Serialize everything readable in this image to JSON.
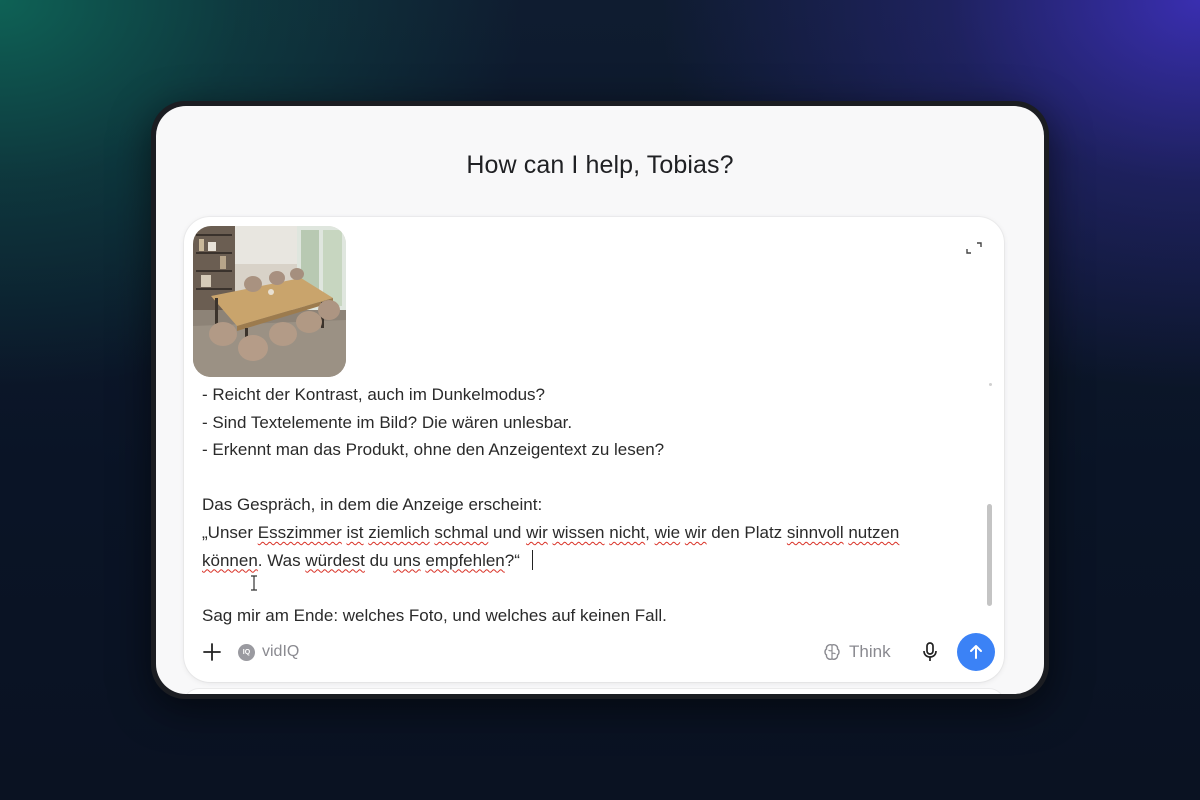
{
  "greeting": "How can I help, Tobias?",
  "prompt_lines": [
    [
      {
        "t": "- Reicht der Kontrast, auch im Dunkelmodus?"
      }
    ],
    [
      {
        "t": "- Sind Textelemente im Bild? Die wären unlesbar."
      }
    ],
    [
      {
        "t": "- Erkennt man das Produkt, ohne den Anzeigentext zu lesen?"
      }
    ],
    [],
    [
      {
        "t": "Das Gespräch, in dem die Anzeige erscheint:"
      }
    ],
    [
      {
        "t": "„Unser "
      },
      {
        "t": "Esszimmer",
        "s": 1
      },
      {
        "t": " "
      },
      {
        "t": "ist",
        "s": 1
      },
      {
        "t": " "
      },
      {
        "t": "ziemlich",
        "s": 1
      },
      {
        "t": " "
      },
      {
        "t": "schmal",
        "s": 1
      },
      {
        "t": " und "
      },
      {
        "t": "wir",
        "s": 1
      },
      {
        "t": " "
      },
      {
        "t": "wissen",
        "s": 1
      },
      {
        "t": " "
      },
      {
        "t": "nicht",
        "s": 1
      },
      {
        "t": ", "
      },
      {
        "t": "wie",
        "s": 1
      },
      {
        "t": " "
      },
      {
        "t": "wir",
        "s": 1
      },
      {
        "t": " den Platz "
      },
      {
        "t": "sinnvoll",
        "s": 1
      },
      {
        "t": " "
      },
      {
        "t": "nutzen",
        "s": 1
      }
    ],
    [
      {
        "t": "können",
        "s": 1
      },
      {
        "t": ". Was "
      },
      {
        "t": "würdest",
        "s": 1
      },
      {
        "t": " du "
      },
      {
        "t": "uns",
        "s": 1
      },
      {
        "t": " "
      },
      {
        "t": "empfehlen",
        "s": 1
      },
      {
        "t": "?“"
      }
    ],
    [],
    [
      {
        "t": "Sag mir am Ende: welches Foto, und welches auf keinen Fall."
      }
    ]
  ],
  "toolbar": {
    "add_icon": "plus-icon",
    "chip_label": "vidIQ",
    "chip_badge": "IQ",
    "think_label": "Think",
    "think_icon": "brain-icon",
    "mic_icon": "microphone-icon",
    "send_icon": "arrow-up-icon"
  },
  "colors": {
    "send_button": "#3b82f6",
    "spellcheck_underline": "#d93025",
    "muted_text": "#8a8a90"
  }
}
